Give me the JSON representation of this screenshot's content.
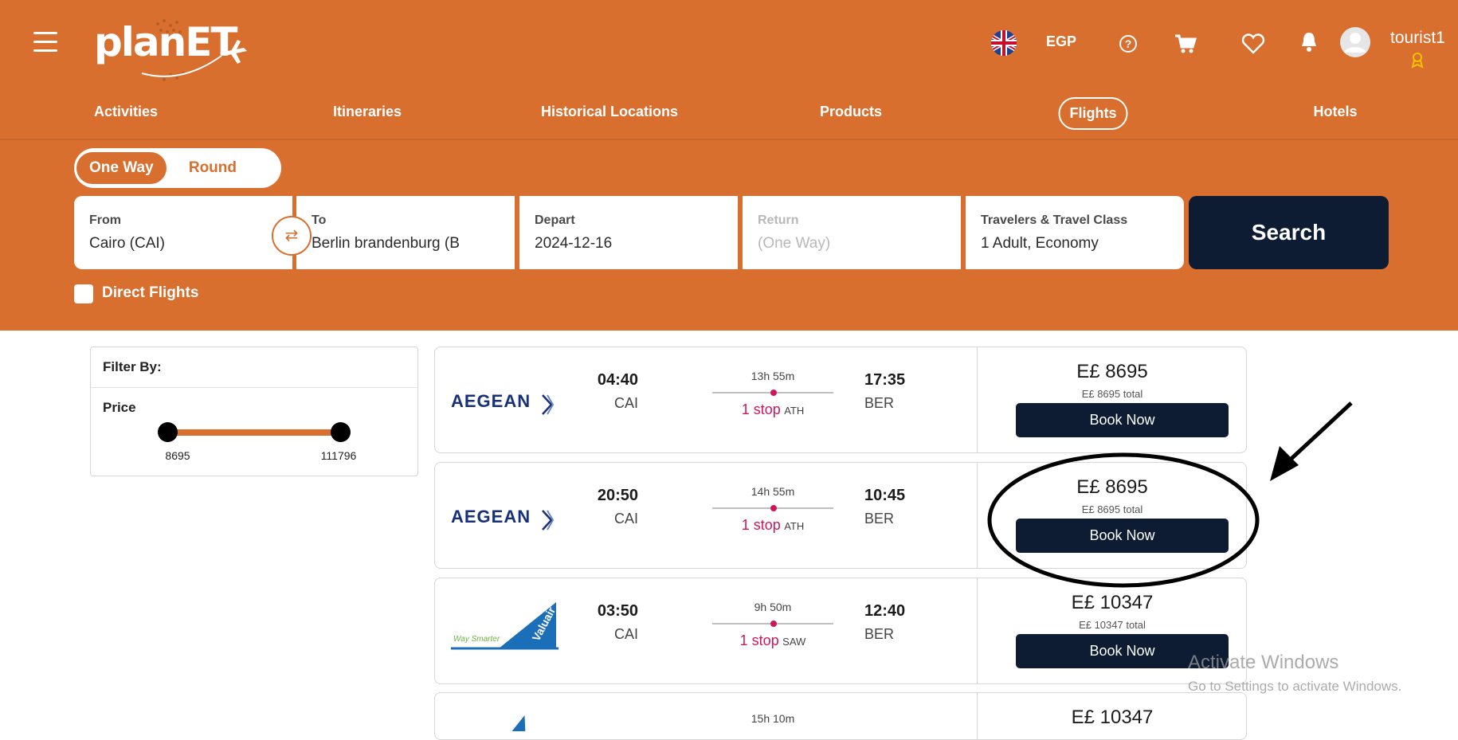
{
  "header": {
    "logo_text": "planET",
    "currency": "EGP",
    "username": "tourist1",
    "icons": [
      "menu-icon",
      "uk-flag-icon",
      "help-icon",
      "cart-icon",
      "heart-icon",
      "bell-icon",
      "avatar-icon",
      "badge-icon"
    ]
  },
  "nav": {
    "items": [
      "Activities",
      "Itineraries",
      "Historical Locations",
      "Products",
      "Flights",
      "Hotels"
    ],
    "active": "Flights"
  },
  "trip_type": {
    "one_way": "One Way",
    "round_trip": "Round Trip",
    "selected": "One Way"
  },
  "search": {
    "from_label": "From",
    "from_value": "Cairo (CAI)",
    "to_label": "To",
    "to_value": "Berlin brandenburg (B",
    "depart_label": "Depart",
    "depart_value": "2024-12-16",
    "return_label": "Return",
    "return_value": "(One Way)",
    "travelers_label": "Travelers & Travel Class",
    "travelers_value": "1 Adult, Economy",
    "search_button": "Search",
    "direct_flights_label": "Direct Flights"
  },
  "filter": {
    "title": "Filter By:",
    "price_title": "Price",
    "min": "8695",
    "max": "111796"
  },
  "flights": [
    {
      "airline": "AEGEAN",
      "depart_time": "04:40",
      "depart_code": "CAI",
      "duration": "13h 55m",
      "stops": "1 stop",
      "stop_airport": "ATH",
      "arrive_time": "17:35",
      "arrive_code": "BER",
      "price": "E£ 8695",
      "total": "E£ 8695 total",
      "book": "Book Now"
    },
    {
      "airline": "AEGEAN",
      "depart_time": "20:50",
      "depart_code": "CAI",
      "duration": "14h 55m",
      "stops": "1 stop",
      "stop_airport": "ATH",
      "arrive_time": "10:45",
      "arrive_code": "BER",
      "price": "E£ 8695",
      "total": "E£ 8695 total",
      "book": "Book Now"
    },
    {
      "airline": "Valuair",
      "airline_tagline": "Way Smarter",
      "depart_time": "03:50",
      "depart_code": "CAI",
      "duration": "9h 50m",
      "stops": "1 stop",
      "stop_airport": "SAW",
      "arrive_time": "12:40",
      "arrive_code": "BER",
      "price": "E£ 10347",
      "total": "E£ 10347 total",
      "book": "Book Now"
    },
    {
      "airline": "Valuair",
      "duration": "15h 10m",
      "price": "E£ 10347"
    }
  ],
  "watermark": {
    "title": "Activate Windows",
    "subtitle": "Go to Settings to activate Windows."
  },
  "colors": {
    "brand_orange": "#d86f2f",
    "navy": "#0d1b33",
    "stop_pink": "#d0165a"
  }
}
